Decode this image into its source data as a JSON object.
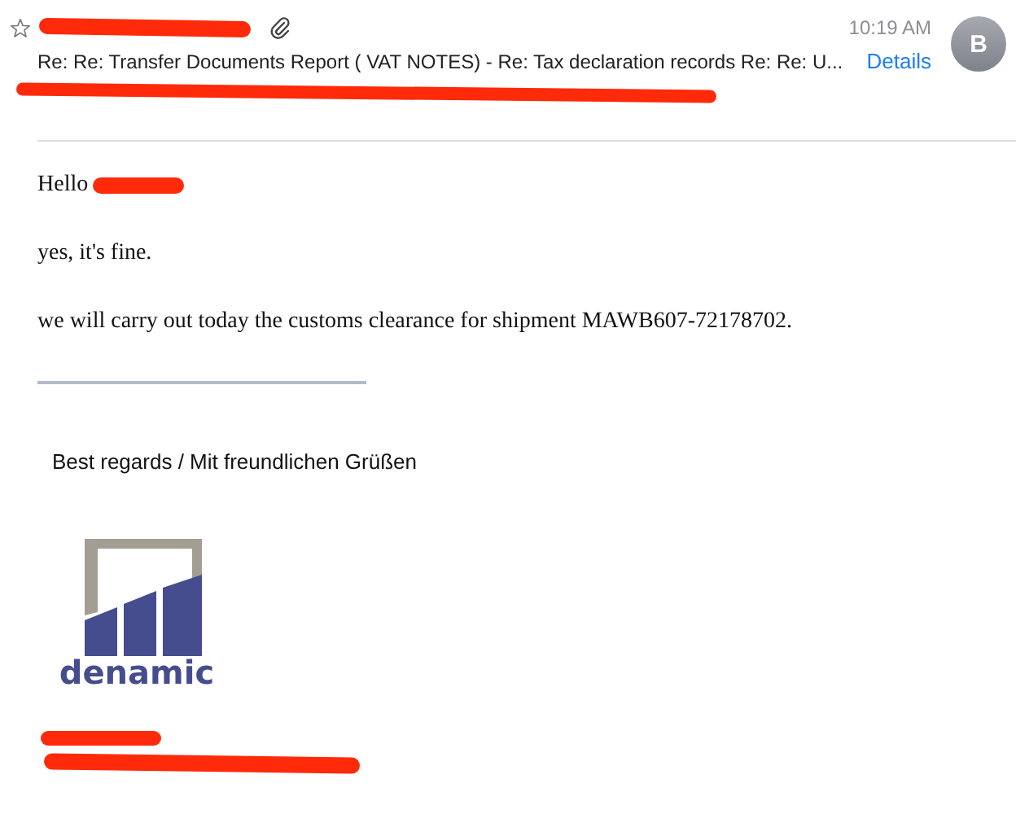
{
  "header": {
    "starred": false,
    "has_attachment": true,
    "time": "10:19 AM",
    "avatar_initial": "B",
    "subject": "Re: Re: Transfer Documents Report ( VAT NOTES)  - Re: Tax declaration records Re: Re: U...",
    "details_link": "Details"
  },
  "body": {
    "greeting": "Hello",
    "paragraphs": [
      "yes, it's fine.",
      "we will carry out today the customs clearance for  shipment MAWB607-72178702."
    ]
  },
  "signature": {
    "closing": "Best regards / Mit freundlichen Grüßen",
    "logo_text": "denamic"
  }
}
